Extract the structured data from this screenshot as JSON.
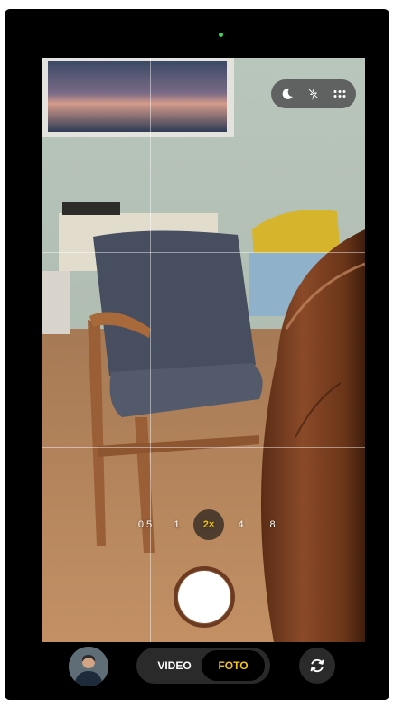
{
  "app": {
    "top_controls": {
      "night_mode_icon": "moon-icon",
      "flash_icon": "flash-off-icon",
      "more_icon": "grid-dots-icon"
    },
    "zoom": {
      "levels": [
        "0.5",
        "1",
        "2×",
        "4",
        "8"
      ],
      "selected": "2×"
    },
    "modes": {
      "video_label": "VIDEO",
      "foto_label": "FOTO",
      "selected": "FOTO"
    },
    "colors": {
      "accent": "#f2c318",
      "status_dot": "#3ad25c"
    },
    "icons": {
      "switch_camera": "camera-switch-icon",
      "gallery": "gallery-thumbnail"
    }
  }
}
